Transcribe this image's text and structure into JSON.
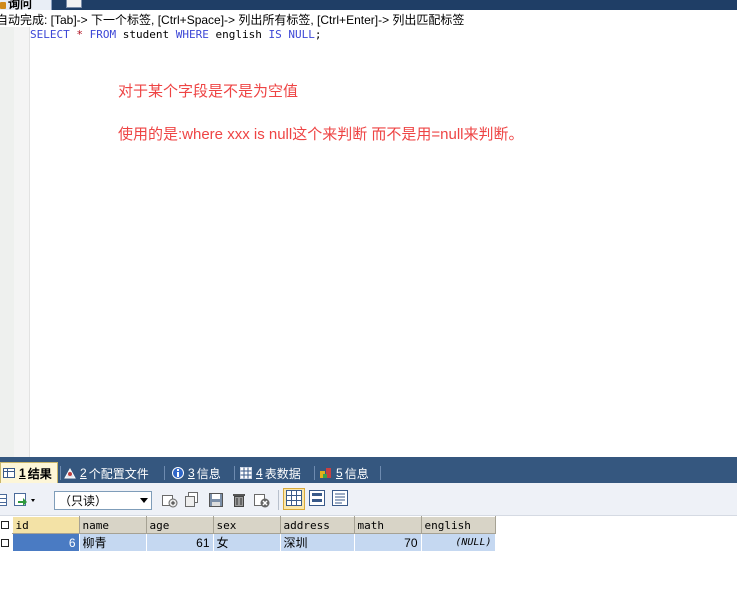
{
  "window": {
    "tab_label": "询问"
  },
  "hint": {
    "text": "自动完成: [Tab]-> 下一个标签, [Ctrl+Space]-> 列出所有标签, [Ctrl+Enter]-> 列出匹配标签"
  },
  "editor": {
    "sql": {
      "kw_select": "SELECT",
      "star": "*",
      "kw_from": "FROM",
      "table": "student",
      "kw_where": "WHERE",
      "column": "english",
      "kw_is": "IS",
      "kw_null": "NULL",
      "semicolon": ";"
    },
    "note_line1": "对于某个字段是不是为空值",
    "note_line2": "使用的是:where xxx is null这个来判断 而不是用=null来判断。",
    "note_color": "#ee4444"
  },
  "result_tabs": [
    {
      "num": "1",
      "label": "结果",
      "icon": "grid-result-icon",
      "active": true
    },
    {
      "num": "2",
      "label": "个配置文件",
      "icon": "profile-icon",
      "active": false
    },
    {
      "num": "3",
      "label": "信息",
      "icon": "info-icon",
      "active": false
    },
    {
      "num": "4",
      "label": "表数据",
      "icon": "table-data-icon",
      "active": false
    },
    {
      "num": "5",
      "label": "信息",
      "icon": "history-info-icon",
      "active": false
    }
  ],
  "toolbar": {
    "readonly_value": "（只读）",
    "icons": [
      "grid-options-icon",
      "export-icon",
      "add-row-icon",
      "duplicate-row-icon",
      "save-icon",
      "delete-icon",
      "cancel-icon",
      "grid-view-icon",
      "form-view-icon",
      "text-view-icon"
    ]
  },
  "grid": {
    "columns": [
      "id",
      "name",
      "age",
      "sex",
      "address",
      "math",
      "english"
    ],
    "rows": [
      {
        "id": "6",
        "name": "柳青",
        "age": "61",
        "sex": "女",
        "address": "深圳",
        "math": "70",
        "english": "(NULL)"
      }
    ]
  },
  "colors": {
    "accent": "#35577f",
    "selection": "#4a7bc3",
    "row": "#c5d8f1",
    "header": "#d8d4c7"
  }
}
